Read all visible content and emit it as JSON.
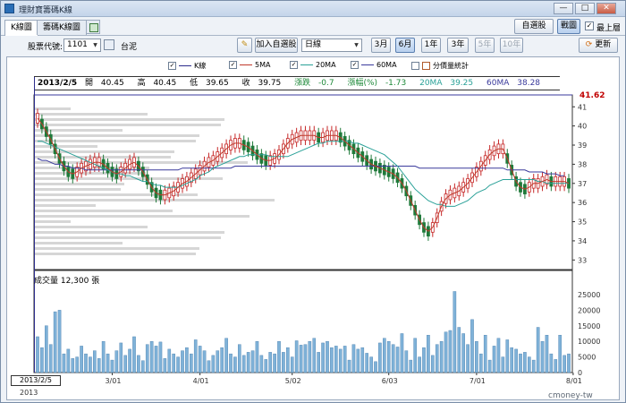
{
  "window": {
    "title": "理財寶籌碼K線",
    "min_label": "—",
    "max_label": "□",
    "close_label": "✕"
  },
  "tabs": [
    {
      "label": "K線圖",
      "active": true
    },
    {
      "label": "籌碼K線圖",
      "active": false
    }
  ],
  "toolbar": {
    "stock_code_label": "股票代號:",
    "stock_code_value": "1101",
    "stock_name": "台泥",
    "add_watchlist_label": "加入自選股",
    "period_value": "日線",
    "range_buttons": [
      "3月",
      "6月",
      "1年",
      "3年",
      "5年",
      "10年"
    ],
    "range_selected": "6月",
    "refresh_label": "更新",
    "watchlist_label": "自選股",
    "drawing_label": "戰圖",
    "topmost_label": "最上層"
  },
  "legend": [
    {
      "label": "K線",
      "checked": true,
      "color": "#2c2c8c"
    },
    {
      "label": "5MA",
      "checked": true,
      "color": "#c0392b"
    },
    {
      "label": "20MA",
      "checked": true,
      "color": "#2aa198"
    },
    {
      "label": "60MA",
      "checked": true,
      "color": "#3a3a9c"
    },
    {
      "label": "分價量統計",
      "checked": false,
      "color": "#b05a2a"
    }
  ],
  "info": {
    "date": "2013/2/5",
    "open_label": "開",
    "open": "40.45",
    "high_label": "高",
    "high": "40.45",
    "low_label": "低",
    "low": "39.65",
    "close_label": "收",
    "close": "39.75",
    "change_label": "漲跌",
    "change": "-0.7",
    "pct_label": "漲幅(%)",
    "pct": "-1.73",
    "ma20_label": "20MA",
    "ma20": "39.25",
    "ma60_label": "60MA",
    "ma60": "38.28"
  },
  "price_marker": "41.62",
  "volume_title": "成交量 12,300 張",
  "date_tip": "2013/2/5",
  "year_label": "2013",
  "watermark": "cmoney-tw",
  "colors": {
    "up": "#c62828",
    "down": "#1f7a3a",
    "volume": "#7fb2d8",
    "ma5": "#c0392b",
    "ma20": "#2aa198",
    "ma60": "#3a3a9c",
    "profile": "#d6d6d6"
  },
  "chart_data": {
    "type": "candlestick",
    "price_axis": {
      "ticks": [
        41,
        40,
        39,
        38,
        37,
        36,
        35,
        34,
        33
      ],
      "ylim": [
        32.5,
        41.62
      ]
    },
    "volume_axis": {
      "ticks": [
        25000,
        20000,
        15000,
        10000,
        5000,
        0
      ],
      "ylim": [
        0,
        27000
      ]
    },
    "x_ticks": [
      {
        "label": "3/01",
        "index": 17
      },
      {
        "label": "4/01",
        "index": 37
      },
      {
        "label": "5/02",
        "index": 58
      },
      {
        "label": "6/03",
        "index": 80
      },
      {
        "label": "7/01",
        "index": 100
      },
      {
        "label": "8/01",
        "index": 122
      }
    ],
    "ma5": [
      40.4,
      40.1,
      39.7,
      39.3,
      38.8,
      38.3,
      37.9,
      37.6,
      37.5,
      37.6,
      37.8,
      37.9,
      38.0,
      38.1,
      38.1,
      38.0,
      37.8,
      37.6,
      37.5,
      37.6,
      37.8,
      38.0,
      38.1,
      37.9,
      37.6,
      37.2,
      36.8,
      36.5,
      36.4,
      36.4,
      36.5,
      36.6,
      36.8,
      37.0,
      37.1,
      37.3,
      37.5,
      37.7,
      37.9,
      38.1,
      38.2,
      38.4,
      38.6,
      38.8,
      39.0,
      39.1,
      39.1,
      39.0,
      38.9,
      38.7,
      38.5,
      38.3,
      38.2,
      38.2,
      38.3,
      38.5,
      38.8,
      39.1,
      39.3,
      39.4,
      39.5,
      39.5,
      39.5,
      39.5,
      39.4,
      39.4,
      39.5,
      39.5,
      39.5,
      39.4,
      39.2,
      39.0,
      38.8,
      38.6,
      38.4,
      38.2,
      38.0,
      37.9,
      37.8,
      37.7,
      37.6,
      37.5,
      37.3,
      37.0,
      36.6,
      36.1,
      35.6,
      35.1,
      34.7,
      34.5,
      34.7,
      35.2,
      35.8,
      36.2,
      36.4,
      36.5,
      36.6,
      36.8,
      37.0,
      37.3,
      37.6,
      37.9,
      38.2,
      38.5,
      38.7,
      38.8,
      38.8,
      38.3,
      37.7,
      37.1,
      36.8,
      36.7,
      36.8,
      37.0,
      37.0,
      37.1,
      37.2,
      37.1,
      37.1,
      37.1,
      37.1,
      37.0
    ],
    "ma20": [
      39.2,
      39.2,
      39.1,
      39.0,
      38.9,
      38.8,
      38.7,
      38.6,
      38.5,
      38.4,
      38.3,
      38.2,
      38.1,
      38.0,
      37.9,
      37.8,
      37.7,
      37.6,
      37.5,
      37.5,
      37.4,
      37.4,
      37.3,
      37.2,
      37.1,
      37.1,
      37.0,
      36.9,
      36.9,
      36.8,
      36.8,
      36.8,
      36.8,
      36.9,
      37.0,
      37.1,
      37.2,
      37.4,
      37.5,
      37.6,
      37.8,
      37.9,
      38.0,
      38.1,
      38.2,
      38.3,
      38.4,
      38.4,
      38.5,
      38.5,
      38.5,
      38.5,
      38.5,
      38.4,
      38.4,
      38.4,
      38.4,
      38.4,
      38.5,
      38.6,
      38.7,
      38.8,
      38.9,
      39.0,
      39.1,
      39.1,
      39.2,
      39.2,
      39.2,
      39.2,
      39.2,
      39.2,
      39.1,
      39.1,
      39.0,
      38.9,
      38.8,
      38.7,
      38.6,
      38.5,
      38.3,
      38.1,
      37.9,
      37.6,
      37.3,
      37.0,
      36.7,
      36.5,
      36.3,
      36.1,
      36.0,
      35.9,
      35.9,
      35.8,
      35.8,
      35.8,
      35.9,
      36.0,
      36.1,
      36.3,
      36.5,
      36.6,
      36.7,
      36.9,
      37.0,
      37.1,
      37.2,
      37.2,
      37.2,
      37.2,
      37.2,
      37.2,
      37.2,
      37.2,
      37.1,
      37.1,
      37.0,
      37.0,
      37.0,
      37.0,
      37.0,
      37.0
    ],
    "ma60": [
      38.3,
      38.2,
      38.2,
      38.1,
      38.0,
      38.0,
      37.9,
      37.9,
      37.8,
      37.8,
      37.8,
      37.7,
      37.7,
      37.7,
      37.7,
      37.7,
      37.7,
      37.7,
      37.7,
      37.7,
      37.7,
      37.7,
      37.7,
      37.7,
      37.7,
      37.7,
      37.7,
      37.7,
      37.7,
      37.7,
      37.7,
      37.7,
      37.7,
      37.8,
      37.8,
      37.8,
      37.8,
      37.8,
      37.8,
      37.8,
      37.8,
      37.8,
      37.8,
      37.8,
      37.8,
      37.9,
      37.9,
      37.9,
      37.9,
      37.9,
      37.9,
      37.9,
      37.9,
      37.9,
      37.9,
      37.9,
      37.9,
      37.9,
      37.9,
      37.9,
      37.9,
      37.9,
      37.9,
      37.9,
      37.9,
      37.9,
      37.9,
      37.9,
      37.9,
      37.9,
      37.9,
      37.9,
      37.9,
      37.9,
      37.9,
      37.9,
      37.9,
      37.9,
      37.9,
      37.9,
      37.9,
      37.9,
      37.9,
      37.9,
      37.9,
      37.9,
      37.9,
      37.8,
      37.8,
      37.8,
      37.8,
      37.8,
      37.8,
      37.8,
      37.8,
      37.8,
      37.8,
      37.8,
      37.8,
      37.8,
      37.8,
      37.8,
      37.8,
      37.8,
      37.8,
      37.8,
      37.8,
      37.7,
      37.7,
      37.7,
      37.7,
      37.7,
      37.6,
      37.6,
      37.6,
      37.6,
      37.5,
      37.5,
      37.5,
      37.4,
      37.4
    ],
    "volume": [
      11500,
      8000,
      15000,
      9000,
      19500,
      20000,
      6000,
      7500,
      4500,
      5000,
      8500,
      6000,
      5000,
      7000,
      4500,
      10000,
      6000,
      4000,
      7000,
      9500,
      5500,
      7500,
      11500,
      5500,
      3800,
      9000,
      10000,
      8500,
      9800,
      4500,
      7500,
      6000,
      5000,
      7000,
      8000,
      6000,
      10500,
      8500,
      7000,
      3800,
      5500,
      7000,
      8000,
      11000,
      6000,
      5000,
      9000,
      5500,
      6500,
      7000,
      10000,
      5500,
      4200,
      6500,
      6000,
      10000,
      6500,
      8000,
      5000,
      10200,
      8800,
      9000,
      10000,
      11000,
      6500,
      9500,
      10000,
      8000,
      8500,
      7500,
      8500,
      4000,
      9000,
      7500,
      8000,
      6200,
      5000,
      3500,
      9500,
      11000,
      10000,
      9000,
      8200,
      12500,
      7000,
      4000,
      11000,
      5000,
      8000,
      12000,
      5500,
      9000,
      10000,
      13000,
      13500,
      26000,
      14500,
      12500,
      9000,
      17000,
      10000,
      6000,
      12000,
      4000,
      8500,
      11000,
      5000,
      10500,
      8000,
      7500,
      6000,
      6500,
      5000,
      4000,
      14500,
      10000,
      12000,
      6000,
      4200,
      12000,
      5500,
      6000
    ]
  }
}
